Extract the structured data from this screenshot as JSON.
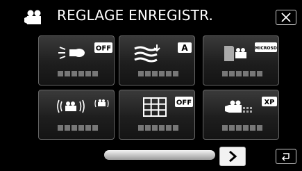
{
  "header": {
    "title": "REGLAGE ENREGISTR.",
    "mode_icon": "video-camera-icon",
    "close_icon": "close-icon"
  },
  "tiles": [
    {
      "name": "video-light-tile",
      "icon": "video-light-icon",
      "badge": "OFF"
    },
    {
      "name": "wind-cut-tile",
      "icon": "wind-cut-icon",
      "badge": "A"
    },
    {
      "name": "media-select-tile",
      "icon": "media-select-icon",
      "badge": "MICROSD"
    },
    {
      "name": "image-stabilizer-tile",
      "icon": "image-stabilizer-icon",
      "badge": ""
    },
    {
      "name": "grid-lines-tile",
      "icon": "grid-icon",
      "badge": "OFF"
    },
    {
      "name": "video-quality-tile",
      "icon": "video-quality-icon",
      "badge": "XP"
    }
  ],
  "footer": {
    "next_icon": "chevron-right-icon",
    "back_icon": "return-icon"
  },
  "colors": {
    "background": "#000000",
    "tile_top": "#3a3a3a",
    "text": "#ffffff"
  }
}
